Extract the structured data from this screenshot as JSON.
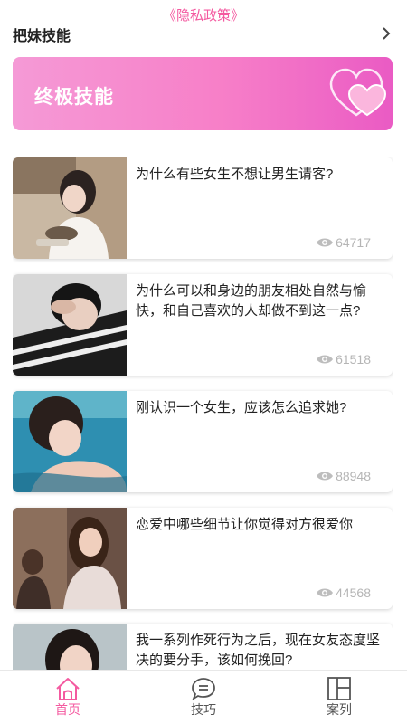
{
  "privacy_link": "《隐私政策》",
  "header": {
    "title": "把妹技能"
  },
  "banner": {
    "title": "终极技能"
  },
  "colors": {
    "accent": "#f45aa0",
    "banner_start": "#f59ad6",
    "banner_end": "#ea5bc4",
    "views_text": "#b5b5b5"
  },
  "articles": [
    {
      "title": "为什么有些女生不想让男生请客?",
      "views": "64717"
    },
    {
      "title": "为什么可以和身边的朋友相处自然与愉快，和自己喜欢的人却做不到这一点?",
      "views": "61518"
    },
    {
      "title": "刚认识一个女生，应该怎么追求她?",
      "views": "88948"
    },
    {
      "title": "恋爱中哪些细节让你觉得对方很爱你",
      "views": "44568"
    },
    {
      "title": "我一系列作死行为之后，现在女友态度坚决的要分手，该如何挽回?",
      "views": ""
    }
  ],
  "tabs": [
    {
      "label": "首页",
      "icon": "home-icon",
      "active": true
    },
    {
      "label": "技巧",
      "icon": "chat-bubble-icon",
      "active": false
    },
    {
      "label": "案列",
      "icon": "layout-icon",
      "active": false
    }
  ]
}
